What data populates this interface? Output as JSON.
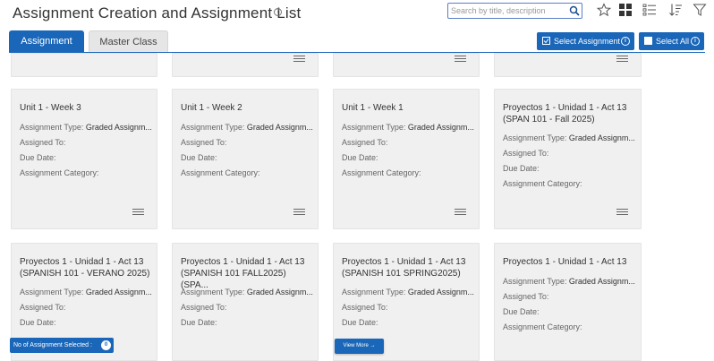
{
  "header": {
    "title": "Assignment Creation and Assignment List",
    "help_glyph": "?",
    "search_placeholder": "Search by title, description"
  },
  "tabs": [
    {
      "label": "Assignment",
      "active": true
    },
    {
      "label": "Master Class",
      "active": false
    }
  ],
  "actions": {
    "select_assignment": "Select Assignment",
    "select_all": "Select All",
    "info_glyph": "i"
  },
  "field_labels": {
    "type": "Assignment Type:",
    "assigned_to": "Assigned To:",
    "due_date": "Due Date:",
    "category": "Assignment Category:"
  },
  "cards_row2": [
    {
      "title": "Unit 1 - Week 3",
      "type": "Graded Assignm..."
    },
    {
      "title": "Unit 1 - Week 2",
      "type": "Graded Assignm..."
    },
    {
      "title": "Unit 1 - Week 1",
      "type": "Graded Assignm..."
    },
    {
      "title": "Proyectos 1 - Unidad 1 - Act 13 (SPAN 101 - Fall 2025)",
      "type": "Graded Assignm..."
    }
  ],
  "cards_row3": [
    {
      "title": "Proyectos 1 - Unidad 1 - Act 13 (SPANISH 101 - VERANO 2025)",
      "type": "Graded Assignm..."
    },
    {
      "title": "Proyectos 1 - Unidad 1 - Act 13 (SPANISH 101 FALL2025) (SPA...",
      "type": "Graded Assignm..."
    },
    {
      "title": "Proyectos 1 - Unidad 1 - Act 13 (SPANISH 101 SPRING2025)",
      "type": "Graded Assignm..."
    },
    {
      "title": "Proyectos 1 - Unidad 1 - Act 13",
      "type": "Graded Assignm..."
    }
  ],
  "footer": {
    "selected_label": "No of Assignment Selected :",
    "selected_count": "0",
    "view_more": "View More →"
  },
  "colors": {
    "primary": "#1a66b8",
    "card_bg": "#f0f0f0"
  }
}
